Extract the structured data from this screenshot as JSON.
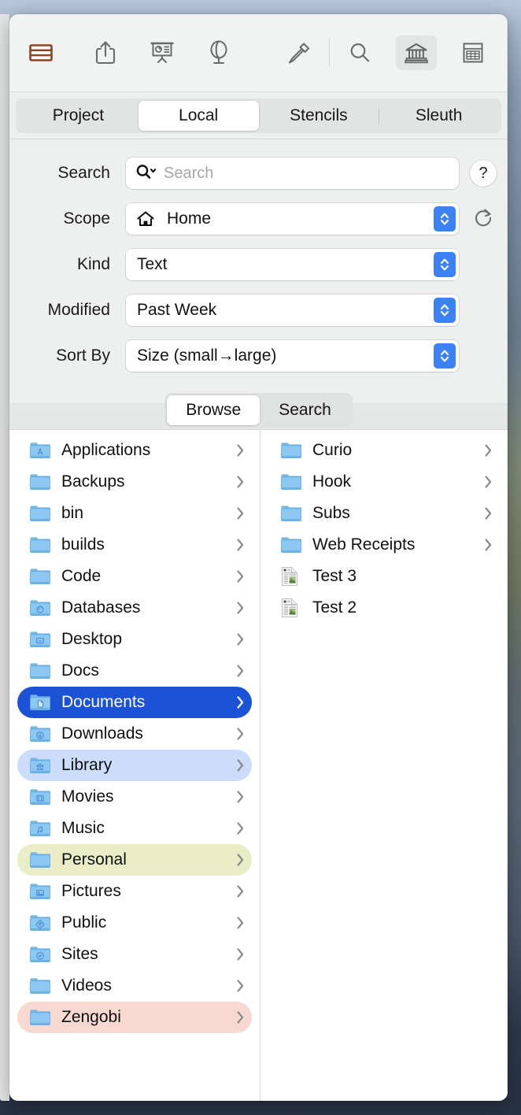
{
  "toolbar": {
    "buttons": [
      {
        "name": "table-icon",
        "label": "Table",
        "accent": "#8a4426",
        "active": false
      },
      {
        "name": "share-icon",
        "label": "Share",
        "active": false
      },
      {
        "name": "presentation-icon",
        "label": "Presentation",
        "active": false
      },
      {
        "name": "globe-icon",
        "label": "Globe",
        "active": false
      },
      {
        "name": "eyedropper-icon",
        "label": "Eyedropper",
        "active": false
      },
      {
        "name": "search-icon",
        "label": "Search",
        "active": false
      },
      {
        "name": "library-icon",
        "label": "Library",
        "active": true
      },
      {
        "name": "calculator-icon",
        "label": "Calculator",
        "active": false
      }
    ]
  },
  "tabs": [
    {
      "label": "Project",
      "selected": false,
      "divider": false
    },
    {
      "label": "Local",
      "selected": true,
      "divider": false
    },
    {
      "label": "Stencils",
      "selected": false,
      "divider": false
    },
    {
      "label": "Sleuth",
      "selected": false,
      "divider": true
    }
  ],
  "form": {
    "search": {
      "label": "Search",
      "value": "",
      "placeholder": "Search",
      "help_label": "?"
    },
    "scope": {
      "label": "Scope",
      "value": "Home",
      "icon": "home-icon"
    },
    "kind": {
      "label": "Kind",
      "value": "Text"
    },
    "modified": {
      "label": "Modified",
      "value": "Past Week"
    },
    "sort_by": {
      "label": "Sort By",
      "value": "Size (small→large)"
    }
  },
  "mode_segment": {
    "items": [
      {
        "label": "Browse",
        "selected": true
      },
      {
        "label": "Search",
        "selected": false
      }
    ]
  },
  "browser": {
    "left_column": [
      {
        "label": "Applications",
        "icon": "folder-applications-icon",
        "chevron": true,
        "state": "none"
      },
      {
        "label": "Backups",
        "icon": "folder-icon",
        "chevron": true,
        "state": "none"
      },
      {
        "label": "bin",
        "icon": "folder-icon",
        "chevron": true,
        "state": "none"
      },
      {
        "label": "builds",
        "icon": "folder-icon",
        "chevron": true,
        "state": "none"
      },
      {
        "label": "Code",
        "icon": "folder-icon",
        "chevron": true,
        "state": "none"
      },
      {
        "label": "Databases",
        "icon": "folder-databases-icon",
        "chevron": true,
        "state": "none"
      },
      {
        "label": "Desktop",
        "icon": "folder-desktop-icon",
        "chevron": true,
        "state": "none"
      },
      {
        "label": "Docs",
        "icon": "folder-icon",
        "chevron": true,
        "state": "none"
      },
      {
        "label": "Documents",
        "icon": "folder-documents-icon",
        "chevron": true,
        "state": "selected"
      },
      {
        "label": "Downloads",
        "icon": "folder-downloads-icon",
        "chevron": true,
        "state": "none"
      },
      {
        "label": "Library",
        "icon": "folder-library-icon",
        "chevron": true,
        "state": "tag-blue"
      },
      {
        "label": "Movies",
        "icon": "folder-movies-icon",
        "chevron": true,
        "state": "none"
      },
      {
        "label": "Music",
        "icon": "folder-music-icon",
        "chevron": true,
        "state": "none"
      },
      {
        "label": "Personal",
        "icon": "folder-icon",
        "chevron": true,
        "state": "tag-yellow"
      },
      {
        "label": "Pictures",
        "icon": "folder-pictures-icon",
        "chevron": true,
        "state": "none"
      },
      {
        "label": "Public",
        "icon": "folder-public-icon",
        "chevron": true,
        "state": "none"
      },
      {
        "label": "Sites",
        "icon": "folder-sites-icon",
        "chevron": true,
        "state": "none"
      },
      {
        "label": "Videos",
        "icon": "folder-icon",
        "chevron": true,
        "state": "none"
      },
      {
        "label": "Zengobi",
        "icon": "folder-icon",
        "chevron": true,
        "state": "tag-red"
      }
    ],
    "right_column": [
      {
        "label": "Curio",
        "icon": "folder-icon",
        "chevron": true,
        "state": "none"
      },
      {
        "label": "Hook",
        "icon": "folder-icon",
        "chevron": true,
        "state": "none"
      },
      {
        "label": "Subs",
        "icon": "folder-icon",
        "chevron": true,
        "state": "none"
      },
      {
        "label": "Web Receipts",
        "icon": "folder-icon",
        "chevron": true,
        "state": "none"
      },
      {
        "label": "Test 3",
        "icon": "document-icon",
        "chevron": false,
        "state": "none"
      },
      {
        "label": "Test 2",
        "icon": "document-icon",
        "chevron": false,
        "state": "none"
      }
    ]
  },
  "colors": {
    "accent_blue": "#1c53d6",
    "stepper_blue": "#3b82f6",
    "tag_blue": "#cbddfb",
    "tag_yellow": "#e9eec6",
    "tag_red": "#f8d9d2",
    "toolbar_accent": "#8a4426"
  }
}
